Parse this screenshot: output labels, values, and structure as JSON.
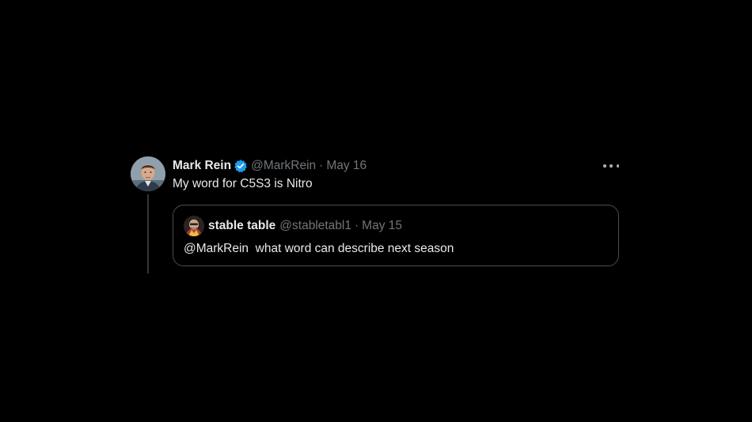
{
  "tweet": {
    "author_name": "Mark Rein",
    "handle": "@MarkRein",
    "separator": "·",
    "date": "May 16",
    "text": "My word for C5S3 is Nitro",
    "verified_color": "#1d9bf0",
    "more_icon": "more-horizontal-icon"
  },
  "quote": {
    "author_name": "stable table",
    "handle": "@stabletabl1",
    "separator": "·",
    "date": "May 15",
    "text": "@MarkRein  what word can describe next season"
  },
  "colors": {
    "background": "#000000",
    "primary_text": "#e7e9ea",
    "muted_text": "#71767b",
    "border": "#4a4d51"
  }
}
